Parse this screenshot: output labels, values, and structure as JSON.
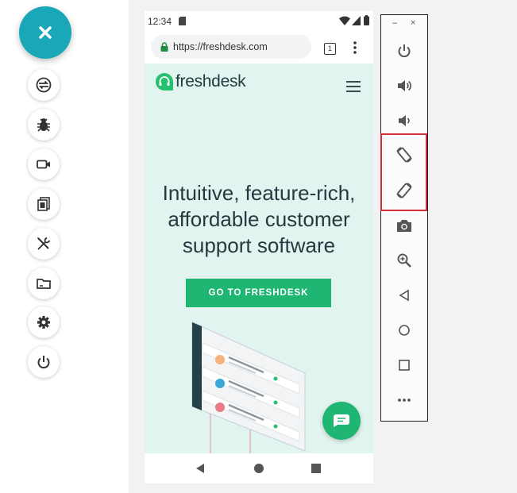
{
  "left_tools": {
    "main_button_icon": "close-icon",
    "items": [
      {
        "name": "screen-mirror-icon"
      },
      {
        "name": "bug-icon"
      },
      {
        "name": "video-camera-icon"
      },
      {
        "name": "screenshots-icon"
      },
      {
        "name": "tools-icon"
      },
      {
        "name": "folder-icon"
      },
      {
        "name": "gear-icon"
      },
      {
        "name": "power-icon"
      }
    ],
    "accent_color": "#1aa7b7"
  },
  "phone": {
    "status_time": "12:34",
    "url": "https://freshdesk.com",
    "tab_count": "1",
    "brand": "freshdesk",
    "headline_lines": [
      "Intuitive, feature-rich,",
      "affordable customer",
      "support software"
    ],
    "cta_label": "GO TO FRESHDESK",
    "brand_color": "#1fb573"
  },
  "control_panel": {
    "minimize": "–",
    "close": "×",
    "items": [
      {
        "name": "power-icon"
      },
      {
        "name": "volume-up-icon"
      },
      {
        "name": "volume-down-icon"
      },
      {
        "name": "rotate-left-icon"
      },
      {
        "name": "rotate-right-icon"
      },
      {
        "name": "camera-icon"
      },
      {
        "name": "zoom-icon"
      },
      {
        "name": "back-icon"
      },
      {
        "name": "home-icon"
      },
      {
        "name": "overview-icon"
      },
      {
        "name": "more-icon"
      }
    ],
    "highlight_color": "#d32f3a"
  }
}
